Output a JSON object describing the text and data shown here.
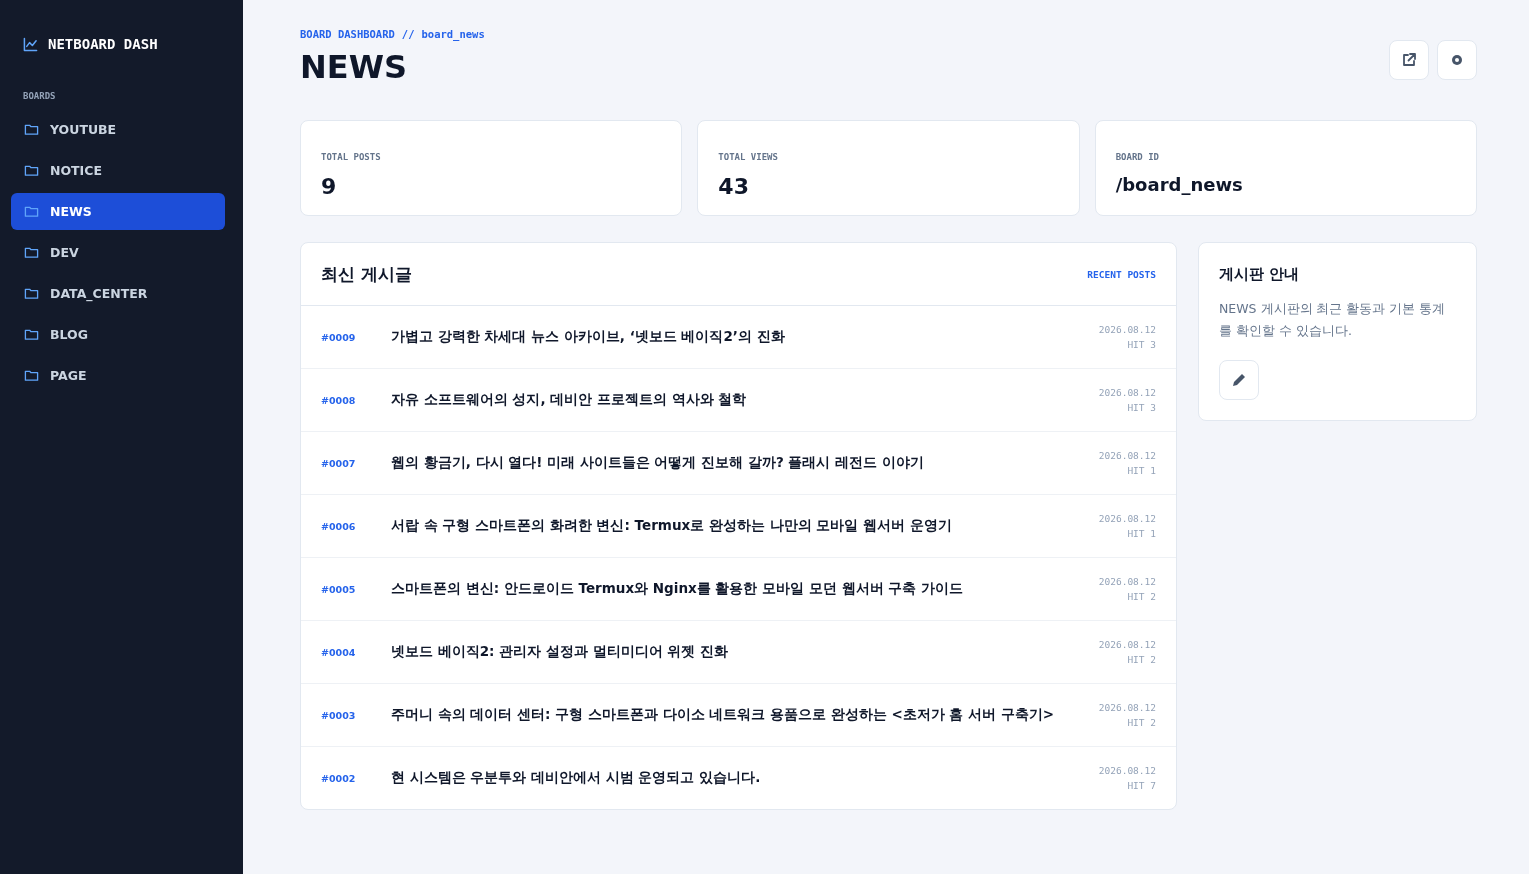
{
  "sidebar": {
    "brand": "NETBOARD DASH",
    "section_label": "BOARDS",
    "items": [
      {
        "label": "YOUTUBE",
        "selected": false
      },
      {
        "label": "NOTICE",
        "selected": false
      },
      {
        "label": "NEWS",
        "selected": true
      },
      {
        "label": "DEV",
        "selected": false
      },
      {
        "label": "DATA_CENTER",
        "selected": false
      },
      {
        "label": "BLOG",
        "selected": false
      },
      {
        "label": "PAGE",
        "selected": false
      }
    ]
  },
  "header": {
    "breadcrumb_root": "BOARD DASHBOARD",
    "breadcrumb_sep": "//",
    "breadcrumb_current": "board_news",
    "title": "NEWS"
  },
  "stats": [
    {
      "label": "TOTAL POSTS",
      "value": "9"
    },
    {
      "label": "TOTAL VIEWS",
      "value": "43"
    },
    {
      "label": "BOARD ID",
      "value": "/board_news"
    }
  ],
  "posts": {
    "title": "최신 게시글",
    "tag": "RECENT POSTS",
    "rows": [
      {
        "id": "#0009",
        "title": "가볍고 강력한 차세대 뉴스 아카이브, ‘넷보드 베이직2’의 진화",
        "date": "2026.08.12",
        "hits": "HIT 3"
      },
      {
        "id": "#0008",
        "title": "자유 소프트웨어의 성지, 데비안 프로젝트의 역사와 철학",
        "date": "2026.08.12",
        "hits": "HIT 3"
      },
      {
        "id": "#0007",
        "title": "웹의 황금기, 다시 열다! 미래 사이트들은 어떻게 진보해 갈까? 플래시 레전드 이야기",
        "date": "2026.08.12",
        "hits": "HIT 1"
      },
      {
        "id": "#0006",
        "title": "서랍 속 구형 스마트폰의 화려한 변신: Termux로 완성하는 나만의 모바일 웹서버 운영기",
        "date": "2026.08.12",
        "hits": "HIT 1"
      },
      {
        "id": "#0005",
        "title": "스마트폰의 변신: 안드로이드 Termux와 Nginx를 활용한 모바일 모던 웹서버 구축 가이드",
        "date": "2026.08.12",
        "hits": "HIT 2"
      },
      {
        "id": "#0004",
        "title": "넷보드 베이직2: 관리자 설정과 멀티미디어 위젯 진화",
        "date": "2026.08.12",
        "hits": "HIT 2"
      },
      {
        "id": "#0003",
        "title": "주머니 속의 데이터 센터: 구형 스마트폰과 다이소 네트워크 용품으로 완성하는 <초저가 홈 서버 구축기>",
        "date": "2026.08.12",
        "hits": "HIT 2"
      },
      {
        "id": "#0002",
        "title": "현 시스템은 우분투와 데비안에서 시범 운영되고 있습니다.",
        "date": "2026.08.12",
        "hits": "HIT 7"
      }
    ]
  },
  "info": {
    "title": "게시판 안내",
    "text": "NEWS 게시판의 최근 활동과 기본 통계를 확인할 수 있습니다."
  }
}
